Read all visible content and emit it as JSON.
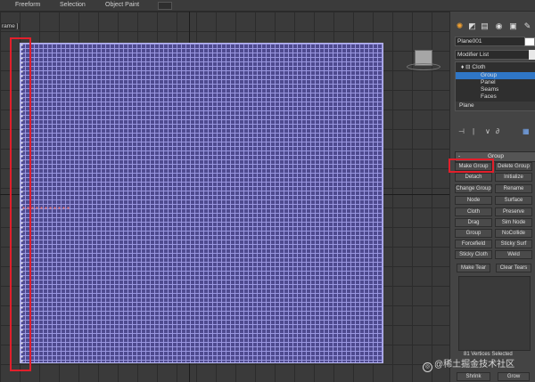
{
  "topbar": {
    "tabs": [
      "Freeform",
      "Selection",
      "Object Paint"
    ]
  },
  "viewport": {
    "label": "rame ]"
  },
  "panel": {
    "command_tabs": [
      "create-icon",
      "modify-icon",
      "hierarchy-icon",
      "motion-icon",
      "display-icon",
      "utilities-icon"
    ],
    "object_name": "Plane001",
    "modifier_list": "Modifier List",
    "stack": {
      "items": [
        {
          "label": "Cloth",
          "selected": false
        },
        {
          "label": "Group",
          "selected": true
        },
        {
          "label": "Panel",
          "selected": false
        },
        {
          "label": "Seams",
          "selected": false
        },
        {
          "label": "Faces",
          "selected": false
        }
      ],
      "base": "Plane"
    },
    "rollout_title": "Group",
    "buttons": [
      [
        "Make Group",
        "Delete Group"
      ],
      [
        "Detach",
        "Initialize"
      ],
      [
        "Change Group",
        "Rename"
      ],
      [
        "Node",
        "Surface"
      ],
      [
        "Cloth",
        "Preserve"
      ],
      [
        "Drag",
        "Sim Node"
      ],
      [
        "Group",
        "NoCollide"
      ],
      [
        "Forcefield",
        "Sticky Surf"
      ],
      [
        "Sticky Cloth",
        "Weld"
      ]
    ],
    "make_tear": "Make Tear",
    "clear_tears": "Clear Tears",
    "status": "81 Vertices Selected",
    "bottom_buttons": [
      "Shrink",
      "Grow"
    ]
  },
  "watermark": "@稀土掘金技术社区",
  "colors": {
    "selection_box": "#e21f2b",
    "mesh": "#4e4a8f",
    "stack_selected": "#2f76c6"
  }
}
